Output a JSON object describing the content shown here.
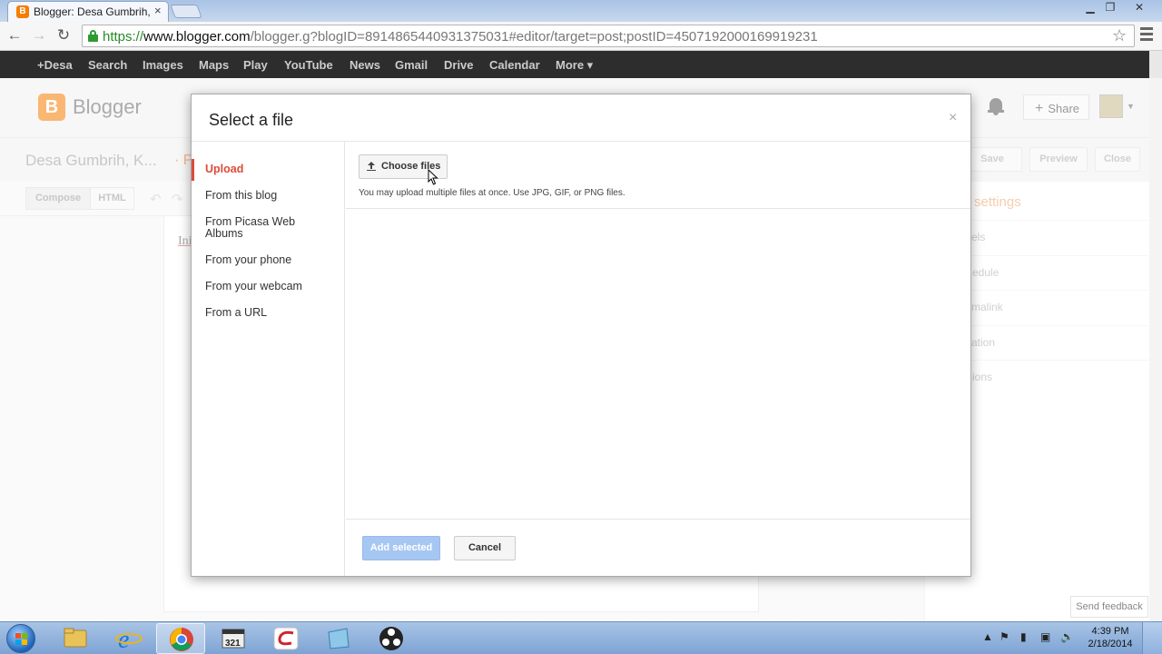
{
  "browser": {
    "tab_title": "Blogger: Desa Gumbrih, K",
    "tab_close": "×",
    "url_scheme": "https://",
    "url_host": "www.blogger.com",
    "url_path": "/blogger.g?blogID=8914865440931375031#editor/target=post;postID=4507192000169919231"
  },
  "google_bar": {
    "items": [
      "+Desa",
      "Search",
      "Images",
      "Maps",
      "Play",
      "YouTube",
      "News",
      "Gmail",
      "Drive",
      "Calendar",
      "More ▾"
    ]
  },
  "blogger": {
    "logo_letter": "B",
    "logo_text": "Blogger",
    "share_label": "Share",
    "blog_name": "Desa Gumbrih, K...",
    "post_sep": "· P",
    "save_label": "Save",
    "preview_label": "Preview",
    "close_label": "Close",
    "compose_label": "Compose",
    "html_label": "HTML",
    "editor_text": "Ini",
    "settings_title": "settings",
    "settings_items": [
      "els",
      "edule",
      "malink",
      "ation",
      "ions"
    ],
    "send_feedback": "Send feedback"
  },
  "dialog": {
    "title": "Select a file",
    "close": "×",
    "nav": [
      {
        "label": "Upload",
        "active": true
      },
      {
        "label": "From this blog",
        "active": false
      },
      {
        "label": "From Picasa Web Albums",
        "active": false
      },
      {
        "label": "From your phone",
        "active": false
      },
      {
        "label": "From your webcam",
        "active": false
      },
      {
        "label": "From a URL",
        "active": false
      }
    ],
    "choose_files": "Choose files",
    "upload_hint": "You may upload multiple files at once. Use JPG, GIF, or PNG files.",
    "add_selected": "Add selected",
    "cancel": "Cancel"
  },
  "taskbar": {
    "time": "4:39 PM",
    "date": "2/18/2014"
  },
  "colors": {
    "accent_red": "#dd4b39",
    "blogger_orange": "#f57d00",
    "add_button": "#a7c7f3"
  }
}
